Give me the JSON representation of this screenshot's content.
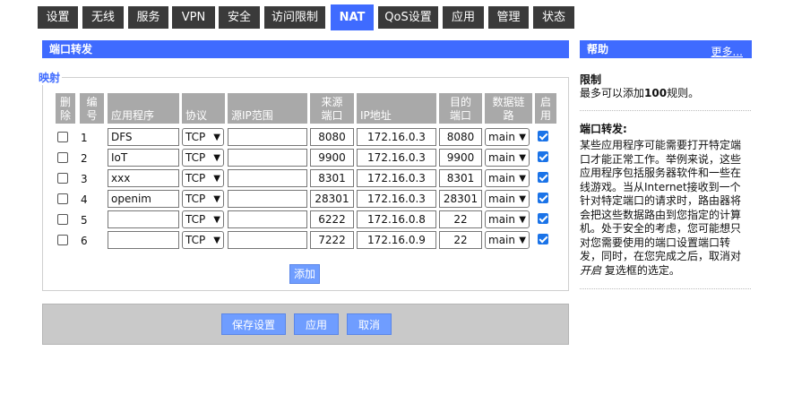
{
  "nav": {
    "tabs": [
      {
        "label": "设置",
        "active": false
      },
      {
        "label": "无线",
        "active": false
      },
      {
        "label": "服务",
        "active": false
      },
      {
        "label": "VPN",
        "active": false
      },
      {
        "label": "安全",
        "active": false
      },
      {
        "label": "访问限制",
        "active": false
      },
      {
        "label": "NAT",
        "active": true
      },
      {
        "label": "QoS设置",
        "active": false
      },
      {
        "label": "应用",
        "active": false
      },
      {
        "label": "管理",
        "active": false
      },
      {
        "label": "状态",
        "active": false
      }
    ]
  },
  "section": {
    "title": "端口转发",
    "legend": "映射"
  },
  "table": {
    "headers": {
      "delete": [
        "删",
        "除"
      ],
      "index": [
        "编",
        "号"
      ],
      "app": "应用程序",
      "protocol": "协议",
      "src_ip": "源IP范围",
      "src_port": [
        "来源",
        "端口"
      ],
      "ip": "IP地址",
      "dst_port": [
        "目的",
        "端口"
      ],
      "chain": [
        "数据链",
        "路"
      ],
      "enable": [
        "启",
        "用"
      ]
    },
    "rows": [
      {
        "index": "1",
        "app": "DFS",
        "protocol": "TCP",
        "src_ip": "",
        "src_port": "8080",
        "ip": "172.16.0.3",
        "dst_port": "8080",
        "chain": "main",
        "enabled": true
      },
      {
        "index": "2",
        "app": "IoT",
        "protocol": "TCP",
        "src_ip": "",
        "src_port": "9900",
        "ip": "172.16.0.3",
        "dst_port": "9900",
        "chain": "main",
        "enabled": true
      },
      {
        "index": "3",
        "app": "xxx",
        "protocol": "TCP",
        "src_ip": "",
        "src_port": "8301",
        "ip": "172.16.0.3",
        "dst_port": "8301",
        "chain": "main",
        "enabled": true
      },
      {
        "index": "4",
        "app": "openim",
        "protocol": "TCP",
        "src_ip": "",
        "src_port": "28301",
        "ip": "172.16.0.3",
        "dst_port": "28301",
        "chain": "main",
        "enabled": true
      },
      {
        "index": "5",
        "app": "",
        "protocol": "TCP",
        "src_ip": "",
        "src_port": "6222",
        "ip": "172.16.0.8",
        "dst_port": "22",
        "chain": "main",
        "enabled": true
      },
      {
        "index": "6",
        "app": "",
        "protocol": "TCP",
        "src_ip": "",
        "src_port": "7222",
        "ip": "172.16.0.9",
        "dst_port": "22",
        "chain": "main",
        "enabled": true
      }
    ],
    "add_label": "添加"
  },
  "footer": {
    "save_label": "保存设置",
    "apply_label": "应用",
    "cancel_label": "取消"
  },
  "help": {
    "title": "帮助",
    "more": "更多...",
    "limit_title": "限制",
    "limit_text_pre": "最多可以添加",
    "limit_count": "100",
    "limit_text_post": "规则。",
    "pf_title": "端口转发:",
    "pf_text": "某些应用程序可能需要打开特定端口才能正常工作。举例来说，这些应用程序包括服务器软件和一些在线游戏。当从Internet接收到一个针对特定端口的请求时，路由器将会把这些数据路由到您指定的计算机。处于安全的考虑，您可能想只对您需要使用的端口设置端口转发，同时，在您完成之后，取消对",
    "pf_italic": "开启",
    "pf_tail": "复选框的选定。"
  }
}
